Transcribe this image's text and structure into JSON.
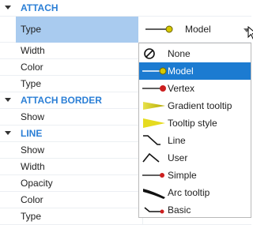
{
  "sections": [
    {
      "label": "ATTACH"
    },
    {
      "label": "ATTACH BORDER"
    },
    {
      "label": "LINE"
    }
  ],
  "rows": {
    "type": "Type",
    "width": "Width",
    "color": "Color",
    "type2": "Type",
    "show": "Show",
    "show2": "Show",
    "width2": "Width",
    "opacity": "Opacity",
    "color2": "Color",
    "type3": "Type"
  },
  "selected_value": "Model",
  "dropdown_options": [
    {
      "label": "None",
      "icon": "none-icon"
    },
    {
      "label": "Model",
      "icon": "model-icon",
      "selected": true
    },
    {
      "label": "Vertex",
      "icon": "vertex-icon"
    },
    {
      "label": "Gradient tooltip",
      "icon": "gradient-tooltip-icon"
    },
    {
      "label": "Tooltip style",
      "icon": "tooltip-style-icon"
    },
    {
      "label": "Line",
      "icon": "line-icon"
    },
    {
      "label": "User",
      "icon": "user-icon"
    },
    {
      "label": "Simple",
      "icon": "simple-icon"
    },
    {
      "label": "Arc tooltip",
      "icon": "arc-tooltip-icon"
    },
    {
      "label": "Basic",
      "icon": "basic-icon"
    }
  ],
  "colors": {
    "section": "#2b7fd6",
    "selection": "#a9cbef",
    "active": "#1c7bd1",
    "marker_model": "#d6c800",
    "marker_vertex": "#cc1f1f"
  }
}
